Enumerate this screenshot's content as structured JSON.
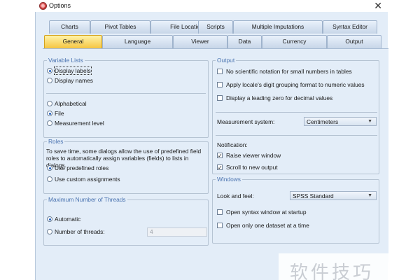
{
  "window": {
    "title": "Options",
    "close_glyph": "✕"
  },
  "tabs_row1": [
    "Charts",
    "Pivot Tables",
    "File Locations",
    "Scripts",
    "Multiple Imputations",
    "Syntax Editor"
  ],
  "tabs_row2": [
    "General",
    "Language",
    "Viewer",
    "Data",
    "Currency",
    "Output"
  ],
  "selected_tab": "General",
  "variable_lists": {
    "legend": "Variable Lists",
    "display_labels": "Display labels",
    "display_names": "Display names",
    "alphabetical": "Alphabetical",
    "file": "File",
    "measurement_level": "Measurement level"
  },
  "roles": {
    "legend": "Roles",
    "description": "To save time, some dialogs allow the use of predefined field roles to automatically assign variables (fields) to lists in dialogs.",
    "use_predefined": "Use predefined roles",
    "use_custom": "Use custom assignments"
  },
  "threads": {
    "legend": "Maximum Number of Threads",
    "automatic": "Automatic",
    "number_of_threads": "Number of threads:",
    "value": "4"
  },
  "output": {
    "legend": "Output",
    "no_scientific": "No scientific notation for small numbers in tables",
    "apply_locale": "Apply locale's digit grouping format to numeric values",
    "leading_zero": "Display a leading zero for decimal values",
    "measurement_system_label": "Measurement system:",
    "measurement_system_value": "Centimeters",
    "notification_label": "Notification:",
    "raise_viewer": "Raise viewer window",
    "scroll_new": "Scroll to new output"
  },
  "windows": {
    "legend": "Windows",
    "look_and_feel_label": "Look and feel:",
    "look_and_feel_value": "SPSS Standard",
    "open_syntax": "Open syntax window at startup",
    "one_dataset": "Open only one dataset at a time"
  },
  "checkbox_states": {
    "no_scientific": false,
    "apply_locale": false,
    "leading_zero": false,
    "raise_viewer": true,
    "scroll_new": true,
    "open_syntax": false,
    "one_dataset": false
  },
  "watermark": "软件技巧",
  "colors": {
    "accent": "#4a73b0",
    "selected_tab": "#f5c542",
    "panel": "#e3edf8"
  }
}
